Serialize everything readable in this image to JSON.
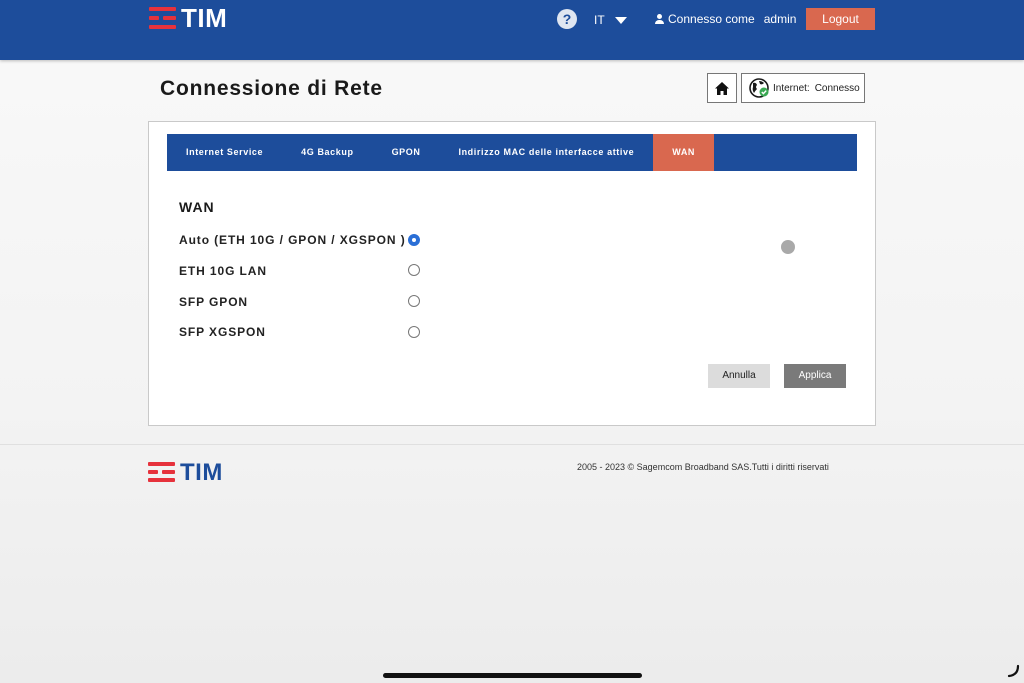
{
  "header": {
    "brand": "TIM",
    "help": "?",
    "language": "IT",
    "user_label": "Connesso come",
    "username": "admin",
    "logout_label": "Logout"
  },
  "page": {
    "title": "Connessione di Rete",
    "internet_label": "Internet:",
    "internet_status": "Connesso"
  },
  "tabs": [
    {
      "label": "Internet Service",
      "active": false
    },
    {
      "label": "4G Backup",
      "active": false
    },
    {
      "label": "GPON",
      "active": false
    },
    {
      "label": "Indirizzo MAC delle interfacce attive",
      "active": false
    },
    {
      "label": "WAN",
      "active": true
    }
  ],
  "wan": {
    "title": "WAN",
    "options": [
      {
        "label": "Auto (ETH 10G / GPON / XGSPON )",
        "selected": true
      },
      {
        "label": "ETH 10G LAN",
        "selected": false
      },
      {
        "label": "SFP GPON",
        "selected": false
      },
      {
        "label": "SFP XGSPON",
        "selected": false
      }
    ],
    "cancel_label": "Annulla",
    "apply_label": "Applica"
  },
  "footer": {
    "brand": "TIM",
    "copyright": "2005 - 2023 © Sagemcom Broadband SAS.Tutti i diritti riservati"
  },
  "colors": {
    "brand_blue": "#1d4d9b",
    "accent_orange": "#d9684f",
    "logo_red": "#e6323c",
    "radio_selected": "#2b6fd6"
  }
}
